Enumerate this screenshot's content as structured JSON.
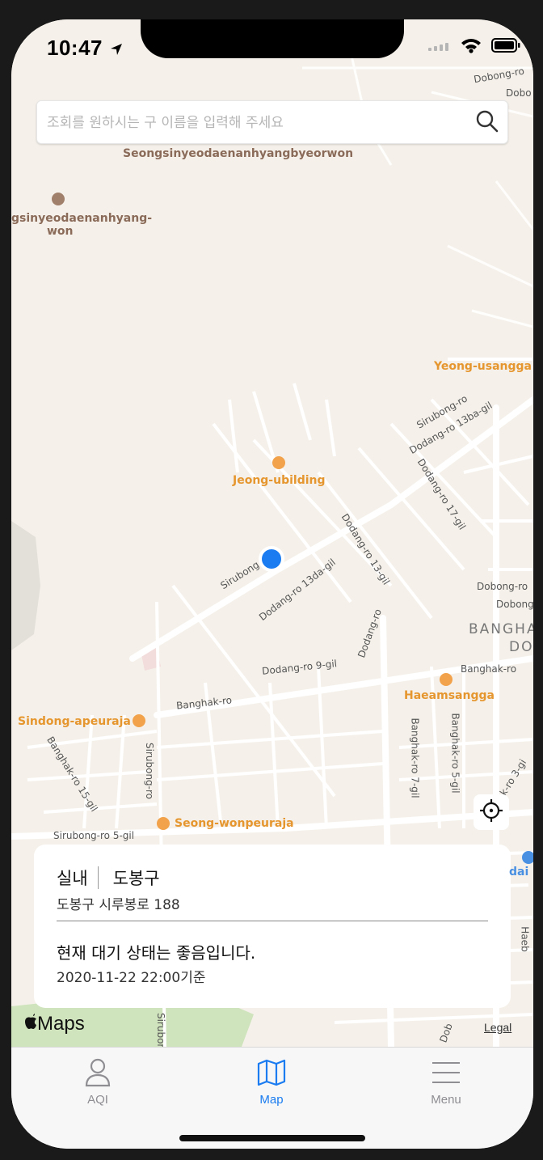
{
  "status_bar": {
    "time": "10:47"
  },
  "search": {
    "placeholder": "조회를 원하시는 구 이름을 입력해 주세요"
  },
  "map": {
    "labels": {
      "seongsin_top": "Seongsinyeodaenanhyangbyeorwon",
      "seongsin_left_1": "gsinyeodaenanhyang-",
      "seongsin_left_2": "won",
      "yeong_usangga": "Yeong-usangga",
      "jeong_ubilding": "Jeong-ubilding",
      "sirubong_ro_right": "Sirubong-ro",
      "dodang_13ba": "Dodang-ro 13ba-gil",
      "dodang_17": "Dodang-ro 17-gil",
      "dodang_13": "Dodang-ro 13-gil",
      "dodang_13da": "Dodang-ro 13da-gil",
      "sirubong_center": "Sirubong",
      "dodang_ro": "Dodang-ro",
      "dodang_9": "Dodang-ro 9-gil",
      "dobong_ro_1": "Dobong-ro",
      "dobong_ro_2": "Dobong",
      "banghak_area_1": "BANGHA",
      "banghak_area_2": "DO",
      "banghak_ro_right": "Banghak-ro",
      "haeamsangga": "Haeamsangga",
      "banghak_ro_left": "Banghak-ro",
      "sindong": "Sindong-apeuraja",
      "banghak_15": "Banghak-ro 15-gil",
      "sirubong_ro_vert": "Sirubong-ro",
      "banghak_7": "Banghak-ro 7-gil",
      "banghak_5": "Banghak-ro 5-gil",
      "banghak_3": "k-ro 3-gi",
      "seong_won": "Seong-wonpeuraja",
      "sirubong_5": "Sirubong-ro 5-gil",
      "dobong_top_1": "Dobong-ro",
      "dobong_top_2": "Dobo",
      "dai": "dai",
      "haeb": "Haeb",
      "sirubo_bottom": "Sirubon",
      "dob_bottom": "Dob"
    },
    "attribution": "Maps",
    "legal": "Legal"
  },
  "info_card": {
    "mode": "실내",
    "district": "도봉구",
    "address": "도봉구 시루봉로 188",
    "air_status": "현재 대기 상태는 좋음입니다.",
    "timestamp": "2020-11-22 22:00기준"
  },
  "tabs": [
    {
      "label": "AQI",
      "icon": "person-icon",
      "active": false
    },
    {
      "label": "Map",
      "icon": "map-icon",
      "active": true
    },
    {
      "label": "Menu",
      "icon": "menu-icon",
      "active": false
    }
  ],
  "colors": {
    "accent": "#1a7cf0",
    "map_bg": "#f5f1ea",
    "road": "#ffffff",
    "poi_orange": "#f2a24a",
    "park_green": "#cfe3bc"
  }
}
